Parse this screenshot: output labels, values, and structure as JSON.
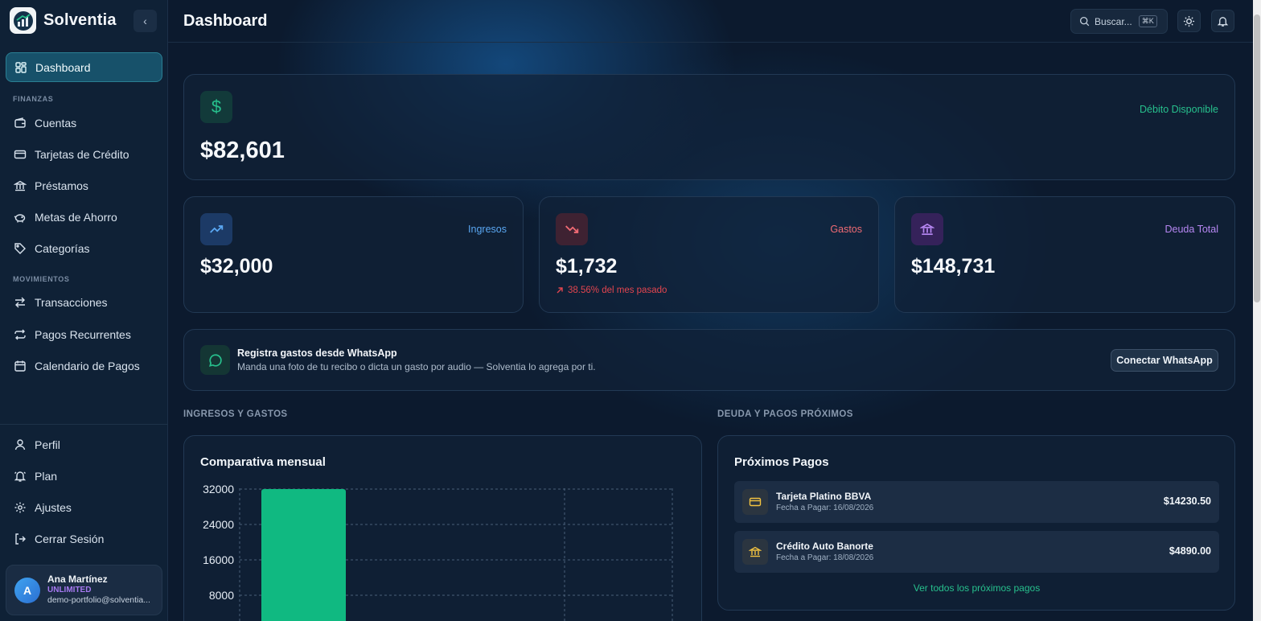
{
  "brand": {
    "name": "Solventia"
  },
  "sidebar": {
    "dashboard_label": "Dashboard",
    "sections": {
      "finanzas": "FINANZAS",
      "movimientos": "MOVIMIENTOS"
    },
    "finanzas_items": [
      "Cuentas",
      "Tarjetas de Crédito",
      "Préstamos",
      "Metas de Ahorro",
      "Categorías"
    ],
    "movimientos_items": [
      "Transacciones",
      "Pagos Recurrentes",
      "Calendario de Pagos"
    ],
    "bottom_items": [
      "Perfil",
      "Plan",
      "Ajustes",
      "Cerrar Sesión"
    ]
  },
  "user": {
    "initial": "A",
    "name": "Ana Martínez",
    "plan": "UNLIMITED",
    "email": "demo-portfolio@solventia..."
  },
  "header": {
    "title": "Dashboard",
    "search_placeholder": "Buscar...",
    "search_shortcut": "⌘K"
  },
  "cards": {
    "debito": {
      "label": "Débito Disponible",
      "value": "$82,601"
    },
    "ingresos": {
      "label": "Ingresos",
      "value": "$32,000"
    },
    "gastos": {
      "label": "Gastos",
      "value": "$1,732",
      "change": "38.56% del mes pasado"
    },
    "deuda": {
      "label": "Deuda Total",
      "value": "$148,731"
    }
  },
  "whatsapp": {
    "title": "Registra gastos desde WhatsApp",
    "description": "Manda una foto de tu recibo o dicta un gasto por audio — Solventia lo agrega por ti.",
    "button": "Conectar WhatsApp"
  },
  "sections": {
    "ingresos_gastos": "INGRESOS Y GASTOS",
    "deuda_pagos": "DEUDA Y PAGOS PRÓXIMOS"
  },
  "chart_data": {
    "type": "bar",
    "title": "Comparativa mensual",
    "yticks": [
      "32000",
      "24000",
      "16000",
      "8000"
    ],
    "ylim": [
      0,
      32000
    ],
    "series": [
      {
        "values": [
          32000
        ]
      }
    ],
    "colors": {
      "bar": "#10b981"
    },
    "grid": true
  },
  "proximos_pagos": {
    "title": "Próximos Pagos",
    "items": [
      {
        "name": "Tarjeta Platino BBVA",
        "date": "Fecha a Pagar: 16/08/2026",
        "amount": "$14230.50",
        "icon": "credit-card-icon"
      },
      {
        "name": "Crédito Auto Banorte",
        "date": "Fecha a Pagar: 18/08/2026",
        "amount": "$4890.00",
        "icon": "bank-icon"
      }
    ],
    "see_all": "Ver todos los próximos pagos"
  },
  "colors": {
    "accent_green": "#27c08d",
    "ingresos_blue": "#5aa7f2",
    "gastos_red": "#f06b74",
    "deuda_purple": "#b687f2"
  }
}
